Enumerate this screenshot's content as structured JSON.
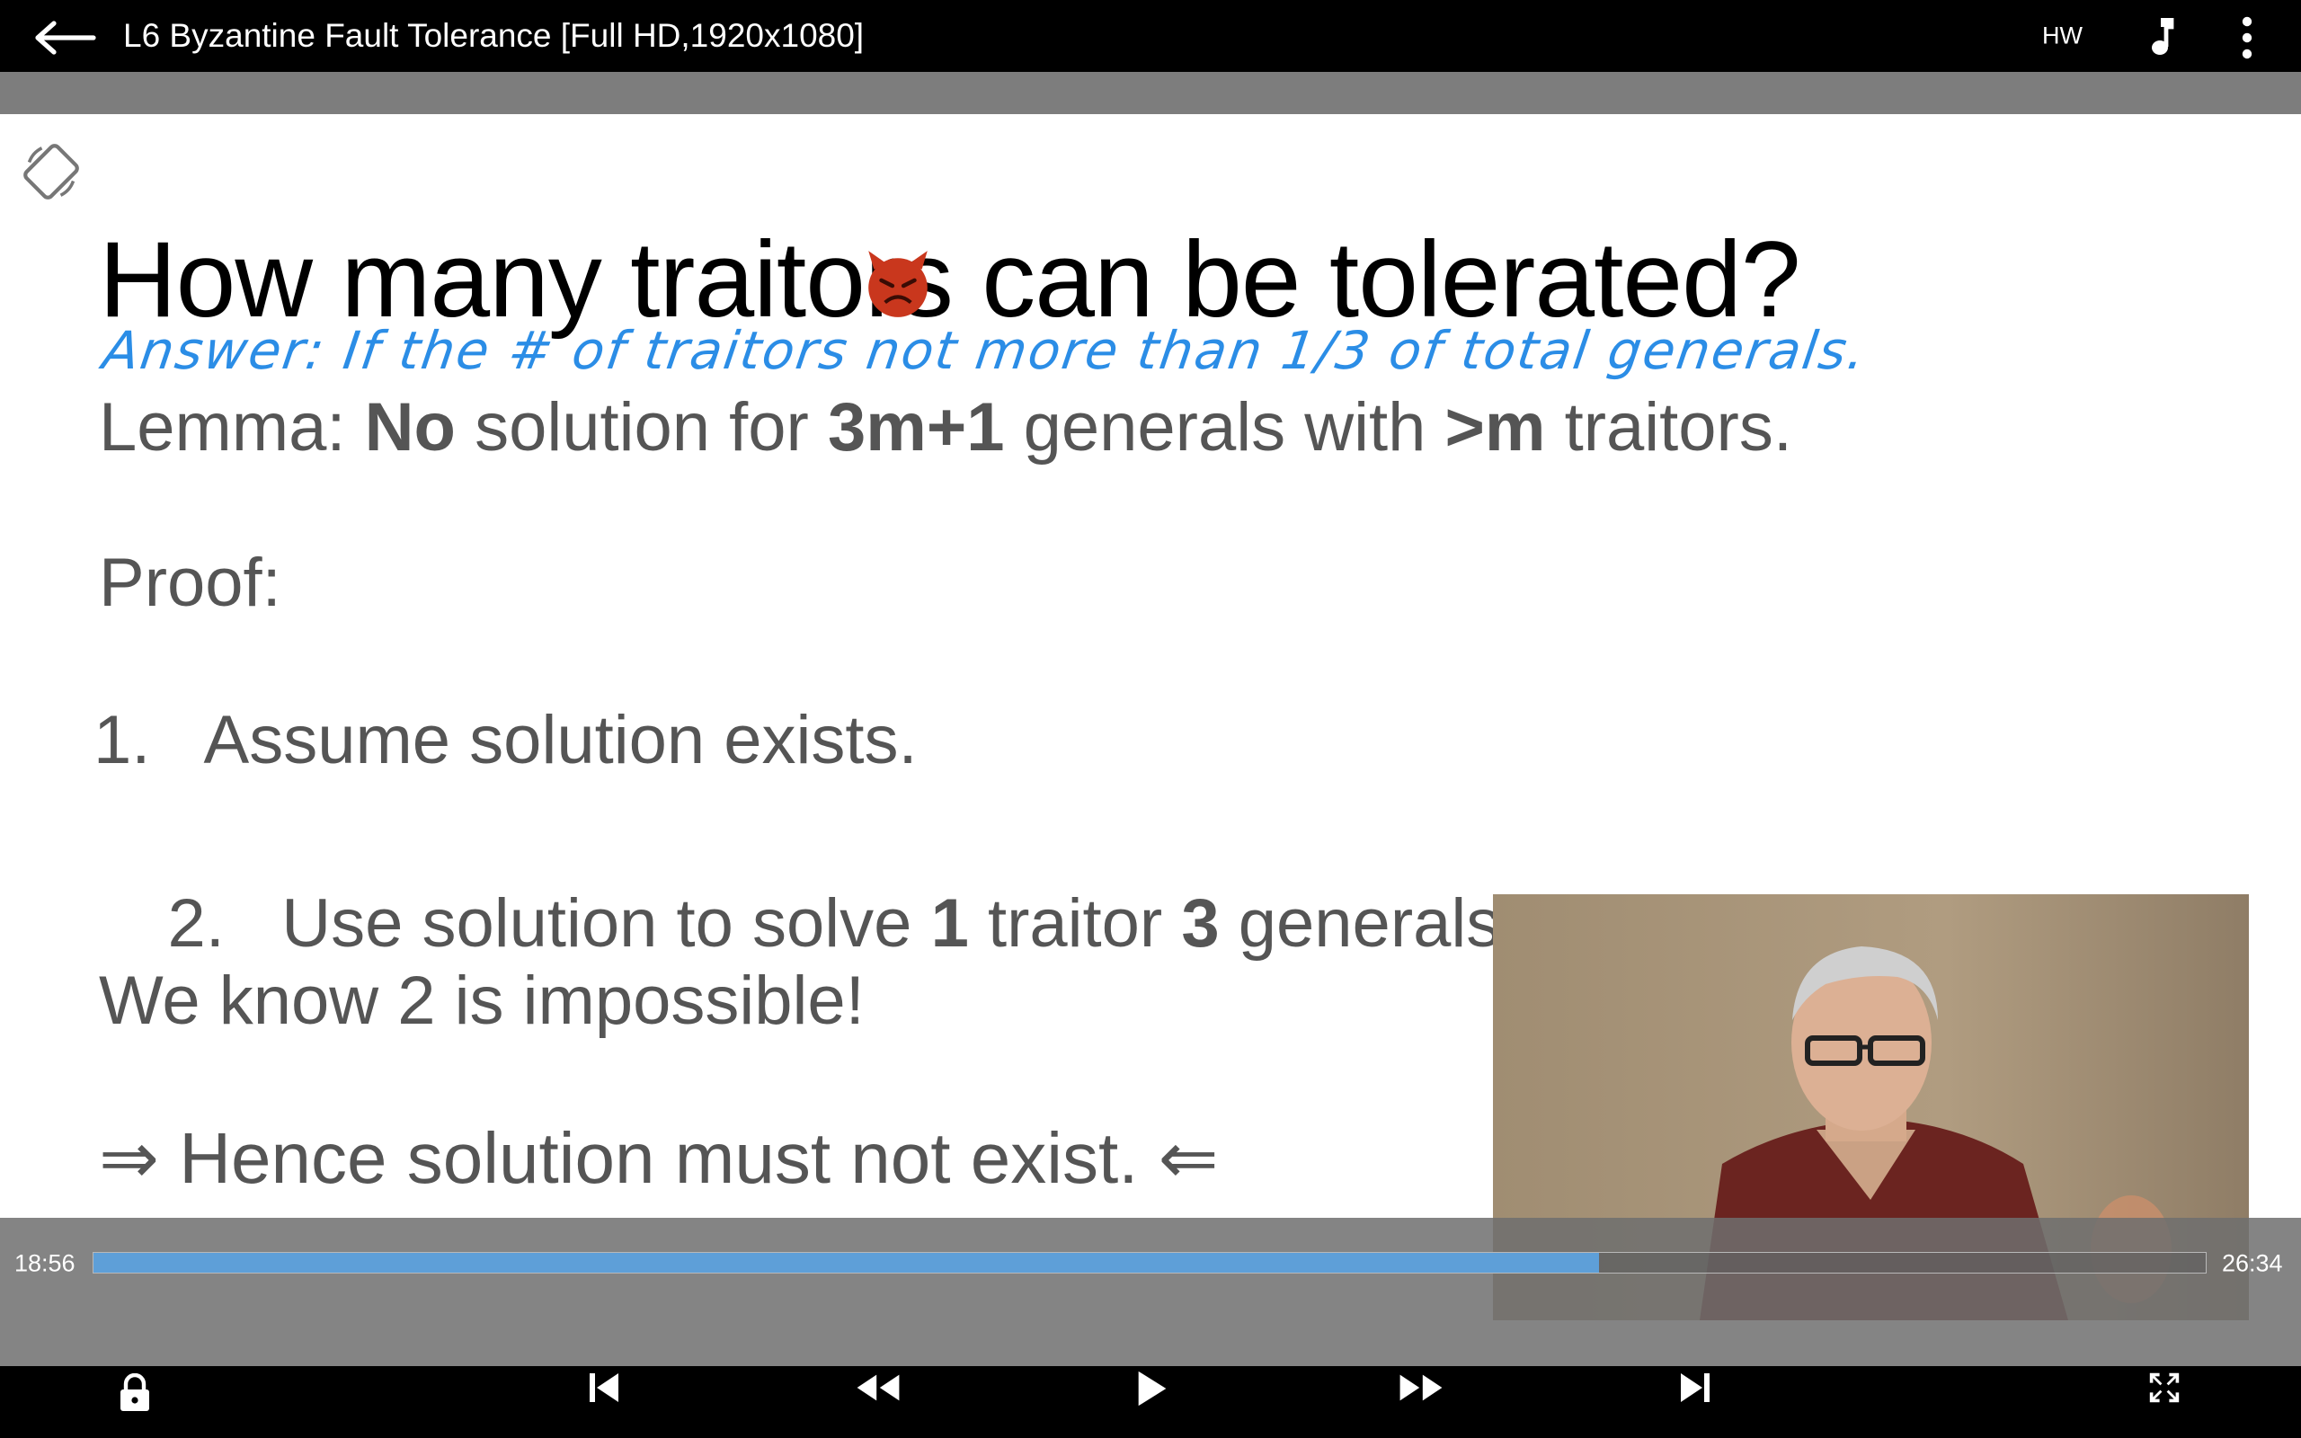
{
  "header": {
    "title": "L6 Byzantine Fault Tolerance [Full HD,1920x1080]",
    "hw_label": "HW"
  },
  "slide": {
    "title": "How many traitors can be tolerated?",
    "annotation": "Answer: If the # of traitors not more than 1/3 of total generals.",
    "lemma": {
      "prefix": "Lemma: ",
      "no": "No",
      "mid1": " solution for ",
      "generals_count": "3m+1",
      "mid2": " generals with ",
      "traitor_count": ">m",
      "suffix": " traitors."
    },
    "proof_label": "Proof:",
    "step1": "1.   Assume solution exists.",
    "step2": {
      "prefix": "2.   Use solution to solve ",
      "one": "1",
      "mid": " traitor ",
      "three": "3",
      "suffix": " generals case."
    },
    "know": "We know 2 is impossible!",
    "hence": "⇒ Hence solution must not exist. ⇐"
  },
  "player": {
    "elapsed": "18:56",
    "total": "26:34",
    "progress_fraction": 0.7126
  },
  "icons": {
    "back": "arrow-back-icon",
    "music": "music-note-icon",
    "more": "more-vert-icon",
    "rotate": "screen-rotation-icon",
    "lock": "lock-icon",
    "prev": "skip-previous-icon",
    "rewind": "fast-rewind-icon",
    "play": "play-icon",
    "forward": "fast-forward-icon",
    "next": "skip-next-icon",
    "fullscreen": "fullscreen-icon"
  },
  "colors": {
    "annotation_ink": "#2b8de6",
    "progress_fill": "#5e9fd8"
  }
}
